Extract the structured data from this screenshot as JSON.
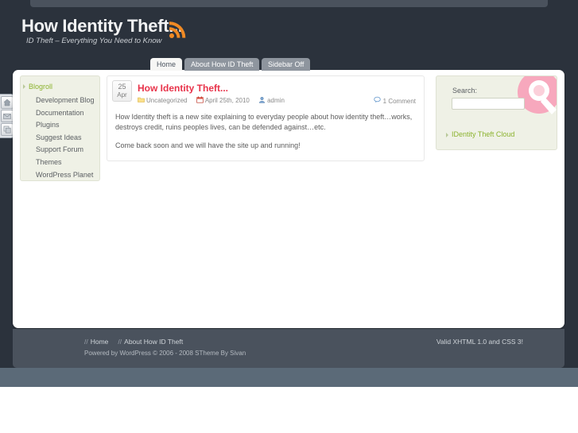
{
  "site": {
    "title": "How Identity Theft...",
    "tagline": "ID Theft – Everything You Need to Know",
    "rss_icon": "rss-feed-icon"
  },
  "nav": {
    "tabs": [
      {
        "label": "Home",
        "active": true
      },
      {
        "label": "About How ID Theft",
        "active": false
      },
      {
        "label": "Sidebar Off",
        "active": false
      }
    ]
  },
  "edge_toolbar": {
    "buttons": [
      {
        "icon": "home-icon"
      },
      {
        "icon": "mail-icon"
      },
      {
        "icon": "windows-icon"
      }
    ]
  },
  "left_sidebar": {
    "widget_title": "Blogroll",
    "links": [
      "Development Blog",
      "Documentation",
      "Plugins",
      "Suggest Ideas",
      "Support Forum",
      "Themes",
      "WordPress Planet"
    ]
  },
  "post": {
    "date_day": "25",
    "date_month": "Apr",
    "title": "How Identity Theft...",
    "meta": {
      "category": "Uncategorized",
      "category_icon": "folder-icon",
      "date": "April 25th, 2010",
      "date_icon": "calendar-icon",
      "author": "admin",
      "author_icon": "user-icon",
      "comments": "1 Comment",
      "comments_icon": "comment-bubble-icon"
    },
    "paragraphs": [
      "How Identity theft is a new site explaining to everyday people about how identity theft…works, destroys credit, ruins peoples lives, can be defended against…etc.",
      "Come back soon and we will have the site up and running!"
    ]
  },
  "right_sidebar": {
    "search_label": "Search:",
    "search_value": "",
    "search_placeholder": "",
    "watermark_icon": "magnifier-q-icon",
    "cloud_link": "IDentity Theft Cloud"
  },
  "footer": {
    "links": [
      "Home",
      "About How ID Theft"
    ],
    "separator": "//",
    "credit": "Powered by WordPress © 2006 - 2008 STheme By Sivan",
    "valid": "Valid XHTML 1.0 and CSS 3!"
  },
  "colors": {
    "page_dark": "#2b323c",
    "page_light": "#5b6a78",
    "accent_red": "#e8334a",
    "accent_green": "#8cb32f",
    "rss_orange": "#f08a24",
    "watermark_pink": "#f7a8bd",
    "footer_bg": "#4a525d"
  }
}
